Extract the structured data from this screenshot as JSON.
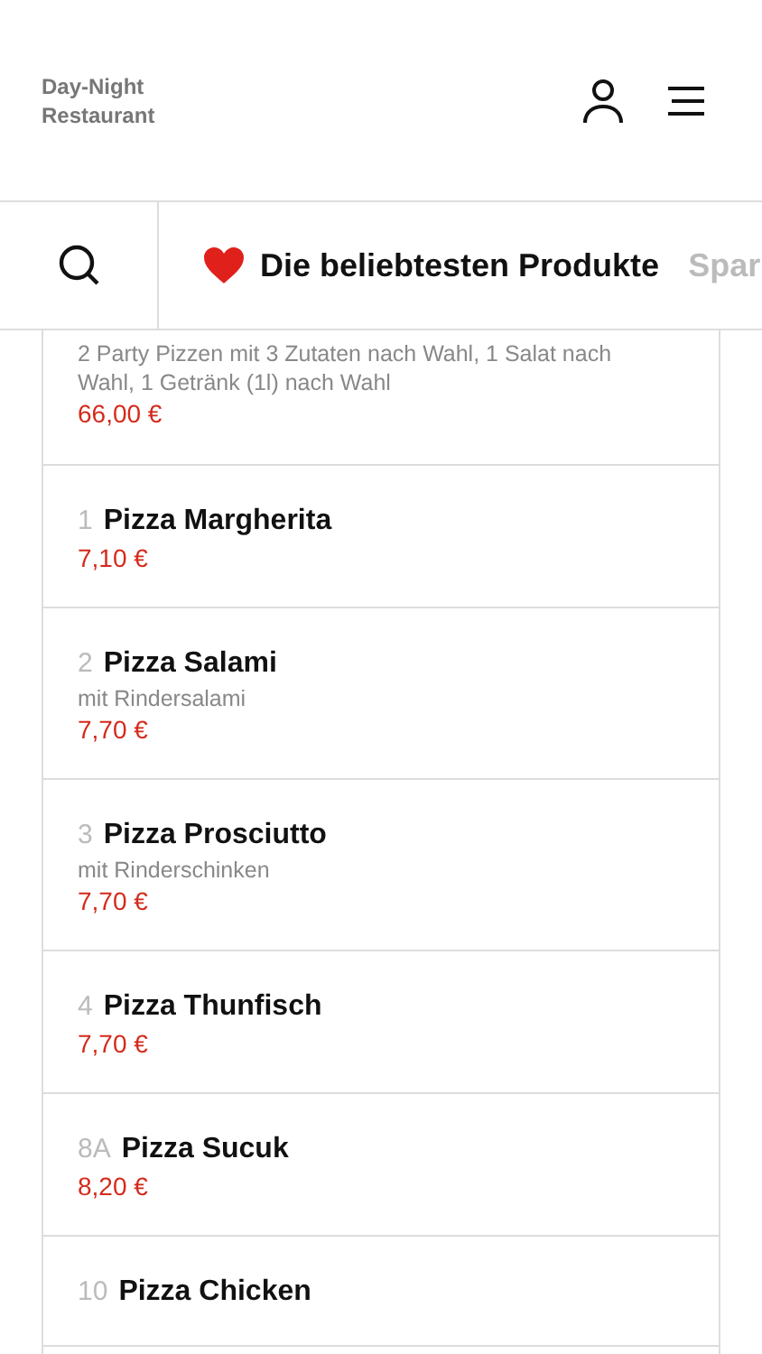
{
  "header": {
    "restaurant_name": "Day-Night Restaurant"
  },
  "category_tabs": [
    {
      "label": "Die beliebtesten Produkte",
      "selected": true,
      "kind": "favorites"
    },
    {
      "label": "Spar",
      "selected": false,
      "kind": "plain"
    }
  ],
  "products": [
    {
      "description": "2 Party Pizzen mit 3 Zutaten nach Wahl, 1 Salat nach Wahl, 1 Getränk (1l) nach Wahl",
      "price": "66,00 €"
    },
    {
      "number": "1",
      "name": "Pizza Margherita",
      "price": "7,10 €"
    },
    {
      "number": "2",
      "name": "Pizza Salami",
      "description": "mit Rindersalami",
      "price": "7,70 €"
    },
    {
      "number": "3",
      "name": "Pizza Prosciutto",
      "description": "mit Rinderschinken",
      "price": "7,70 €"
    },
    {
      "number": "4",
      "name": "Pizza Thunfisch",
      "price": "7,70 €"
    },
    {
      "number": "8A",
      "name": "Pizza Sucuk",
      "price": "8,20 €"
    },
    {
      "number": "10",
      "name": "Pizza Chicken"
    }
  ]
}
